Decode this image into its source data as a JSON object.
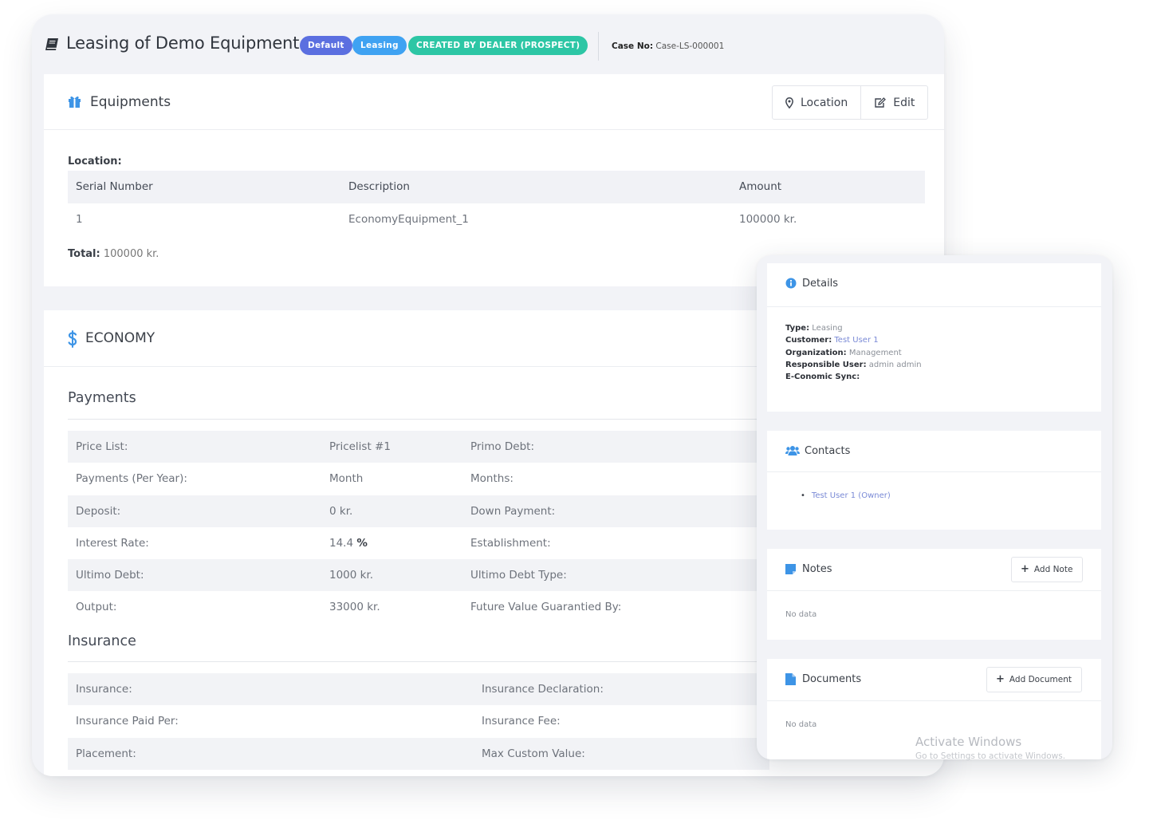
{
  "header": {
    "title": "Leasing of Demo Equipment 1",
    "badges": [
      "Default",
      "Leasing",
      "CREATED BY DEALER (PROSPECT)"
    ],
    "case_label": "Case No:",
    "case_value": "Case-LS-000001"
  },
  "colors": {
    "badge_default": "#5b6fe0",
    "badge_leasing": "#3fa2f2",
    "badge_created": "#2dc6a5",
    "accent_blue": "#3d94e6"
  },
  "equipments": {
    "title": "Equipments",
    "location_button": "Location",
    "edit_button": "Edit",
    "location_label": "Location:",
    "columns": [
      "Serial Number",
      "Description",
      "Amount"
    ],
    "rows": [
      [
        "1",
        "EconomyEquipment_1",
        "100000 kr."
      ]
    ],
    "total_label": "Total:",
    "total_value": "100000 kr."
  },
  "economy": {
    "title": "ECONOMY",
    "payments_heading": "Payments",
    "payments": [
      [
        "Price List:",
        "Pricelist #1",
        "Primo Debt:"
      ],
      [
        "Payments (Per Year):",
        "Month",
        "Months:"
      ],
      [
        "Deposit:",
        "0 kr.",
        "Down Payment:"
      ],
      [
        "Interest Rate:",
        "14.4",
        "Establishment:"
      ],
      [
        "Ultimo Debt:",
        "1000 kr.",
        "Ultimo Debt Type:"
      ],
      [
        "Output:",
        "33000 kr.",
        "Future Value Guarantied By:"
      ]
    ],
    "percent_sign": "%",
    "insurance_heading": "Insurance",
    "insurance": [
      [
        "Insurance:",
        "Insurance Declaration:"
      ],
      [
        "Insurance Paid Per:",
        "Insurance Fee:"
      ],
      [
        "Placement:",
        "Max Custom Value:"
      ]
    ]
  },
  "details": {
    "title": "Details",
    "type_label": "Type:",
    "type_value": "Leasing",
    "customer_label": "Customer:",
    "customer_value": "Test User 1",
    "organization_label": "Organization:",
    "organization_value": "Management",
    "responsible_label": "Responsible User:",
    "responsible_value": "admin admin",
    "sync_label": "E-Conomic Sync:"
  },
  "contacts": {
    "title": "Contacts",
    "items": [
      "Test User 1 (Owner)"
    ]
  },
  "notes": {
    "title": "Notes",
    "add_button": "Add Note",
    "empty": "No data"
  },
  "documents": {
    "title": "Documents",
    "add_button": "Add Document",
    "empty": "No data"
  },
  "watermark": {
    "line1": "Activate Windows",
    "line2": "Go to Settings to activate Windows."
  }
}
